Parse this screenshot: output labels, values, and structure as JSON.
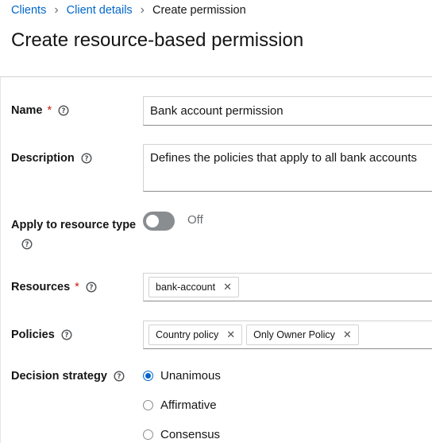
{
  "breadcrumb": {
    "items": [
      "Clients",
      "Client details"
    ],
    "current": "Create permission"
  },
  "page": {
    "title": "Create resource-based permission"
  },
  "form": {
    "name": {
      "label": "Name",
      "value": "Bank account permission"
    },
    "description": {
      "label": "Description",
      "value": "Defines the policies that apply to all bank accounts"
    },
    "apply_to_resource_type": {
      "label_line1": "Apply to resource type",
      "toggle_label": "Off",
      "state": false
    },
    "resources": {
      "label": "Resources",
      "chips": [
        "bank-account"
      ]
    },
    "policies": {
      "label": "Policies",
      "chips": [
        "Country policy",
        "Only Owner Policy"
      ]
    },
    "decision_strategy": {
      "label": "Decision strategy",
      "options": [
        "Unanimous",
        "Affirmative",
        "Consensus"
      ],
      "selected": "Unanimous"
    },
    "required_mark": "*"
  },
  "colors": {
    "link": "#0066cc",
    "required": "#c9190b",
    "toggle_off": "#8a8d90"
  }
}
